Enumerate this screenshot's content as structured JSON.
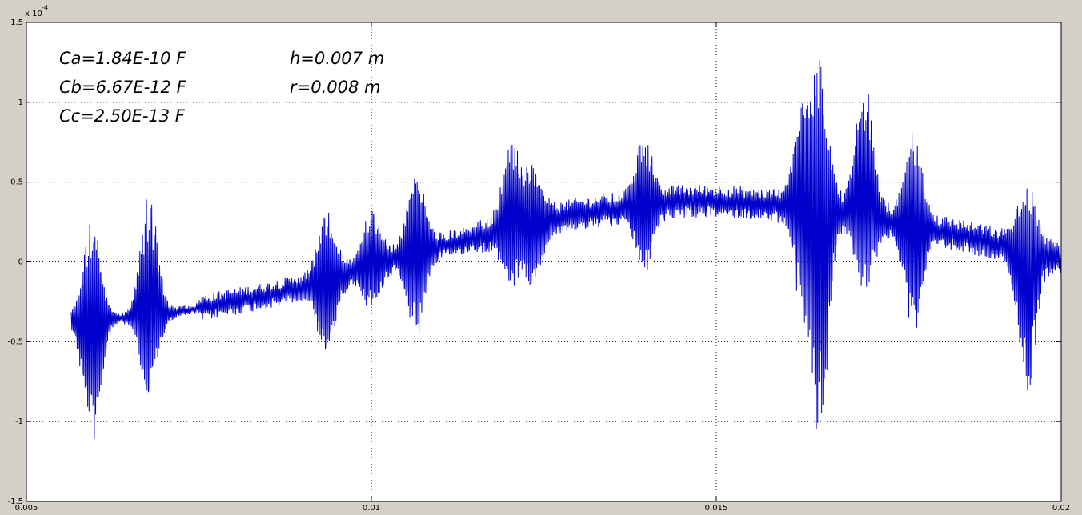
{
  "colors": {
    "figure_background": "#d4d0c8",
    "axes_background": "#ffffff",
    "signal": "#0000cc",
    "grid": "#000000"
  },
  "chart_data": {
    "type": "line",
    "title": "",
    "xlabel": "",
    "ylabel": "",
    "xlim": [
      0.005,
      0.02
    ],
    "ylim": [
      -1.5,
      1.5
    ],
    "y_exponent_label": "x 10",
    "y_exponent_value": "-4",
    "x_ticks": [
      "0.005",
      "0.01",
      "0.015",
      "0.02"
    ],
    "y_ticks": [
      "-1.5",
      "-1",
      "-0.5",
      "0",
      "0.5",
      "1",
      "1.5"
    ],
    "grid": true,
    "line_color": "#0000cc",
    "annotations": [
      "Ca=1.84E-10 F",
      "Cb=6.67E-12 F",
      "Cc=2.50E-13 F",
      "h=0.007 m",
      "r=0.008 m"
    ],
    "series": [
      {
        "baseline": {
          "x": [
            0.00565,
            0.006,
            0.0065,
            0.007,
            0.0075,
            0.008,
            0.0085,
            0.009,
            0.0095,
            0.01,
            0.0105,
            0.011,
            0.0115,
            0.012,
            0.0125,
            0.013,
            0.0135,
            0.014,
            0.0145,
            0.015,
            0.0155,
            0.016,
            0.0165,
            0.017,
            0.0175,
            0.018,
            0.0185,
            0.019,
            0.0195,
            0.02
          ],
          "y": [
            -0.36,
            -0.36,
            -0.35,
            -0.33,
            -0.29,
            -0.25,
            -0.21,
            -0.16,
            -0.1,
            -0.03,
            0.04,
            0.1,
            0.15,
            0.2,
            0.25,
            0.3,
            0.33,
            0.36,
            0.38,
            0.38,
            0.37,
            0.35,
            0.32,
            0.29,
            0.25,
            0.21,
            0.17,
            0.12,
            0.07,
            0.02
          ]
        },
        "bursts": [
          {
            "x": 0.00595,
            "max": 0.25,
            "min": -1.17
          },
          {
            "x": 0.00678,
            "max": 0.42,
            "min": -0.82
          },
          {
            "x": 0.00935,
            "max": 0.25,
            "min": -0.52
          },
          {
            "x": 0.01,
            "max": 0.32,
            "min": -0.24
          },
          {
            "x": 0.01065,
            "max": 0.5,
            "min": -0.45
          },
          {
            "x": 0.01203,
            "max": 0.72,
            "min": -0.08
          },
          {
            "x": 0.01235,
            "max": 0.54,
            "min": -0.08
          },
          {
            "x": 0.01395,
            "max": 0.69,
            "min": 0.0
          },
          {
            "x": 0.01625,
            "max": 0.85,
            "min": -0.2
          },
          {
            "x": 0.0165,
            "max": 1.18,
            "min": -1.03
          },
          {
            "x": 0.01715,
            "max": 1.14,
            "min": -0.13
          },
          {
            "x": 0.01785,
            "max": 0.74,
            "min": -0.37
          },
          {
            "x": 0.0195,
            "max": 0.42,
            "min": -0.8
          }
        ]
      }
    ]
  }
}
